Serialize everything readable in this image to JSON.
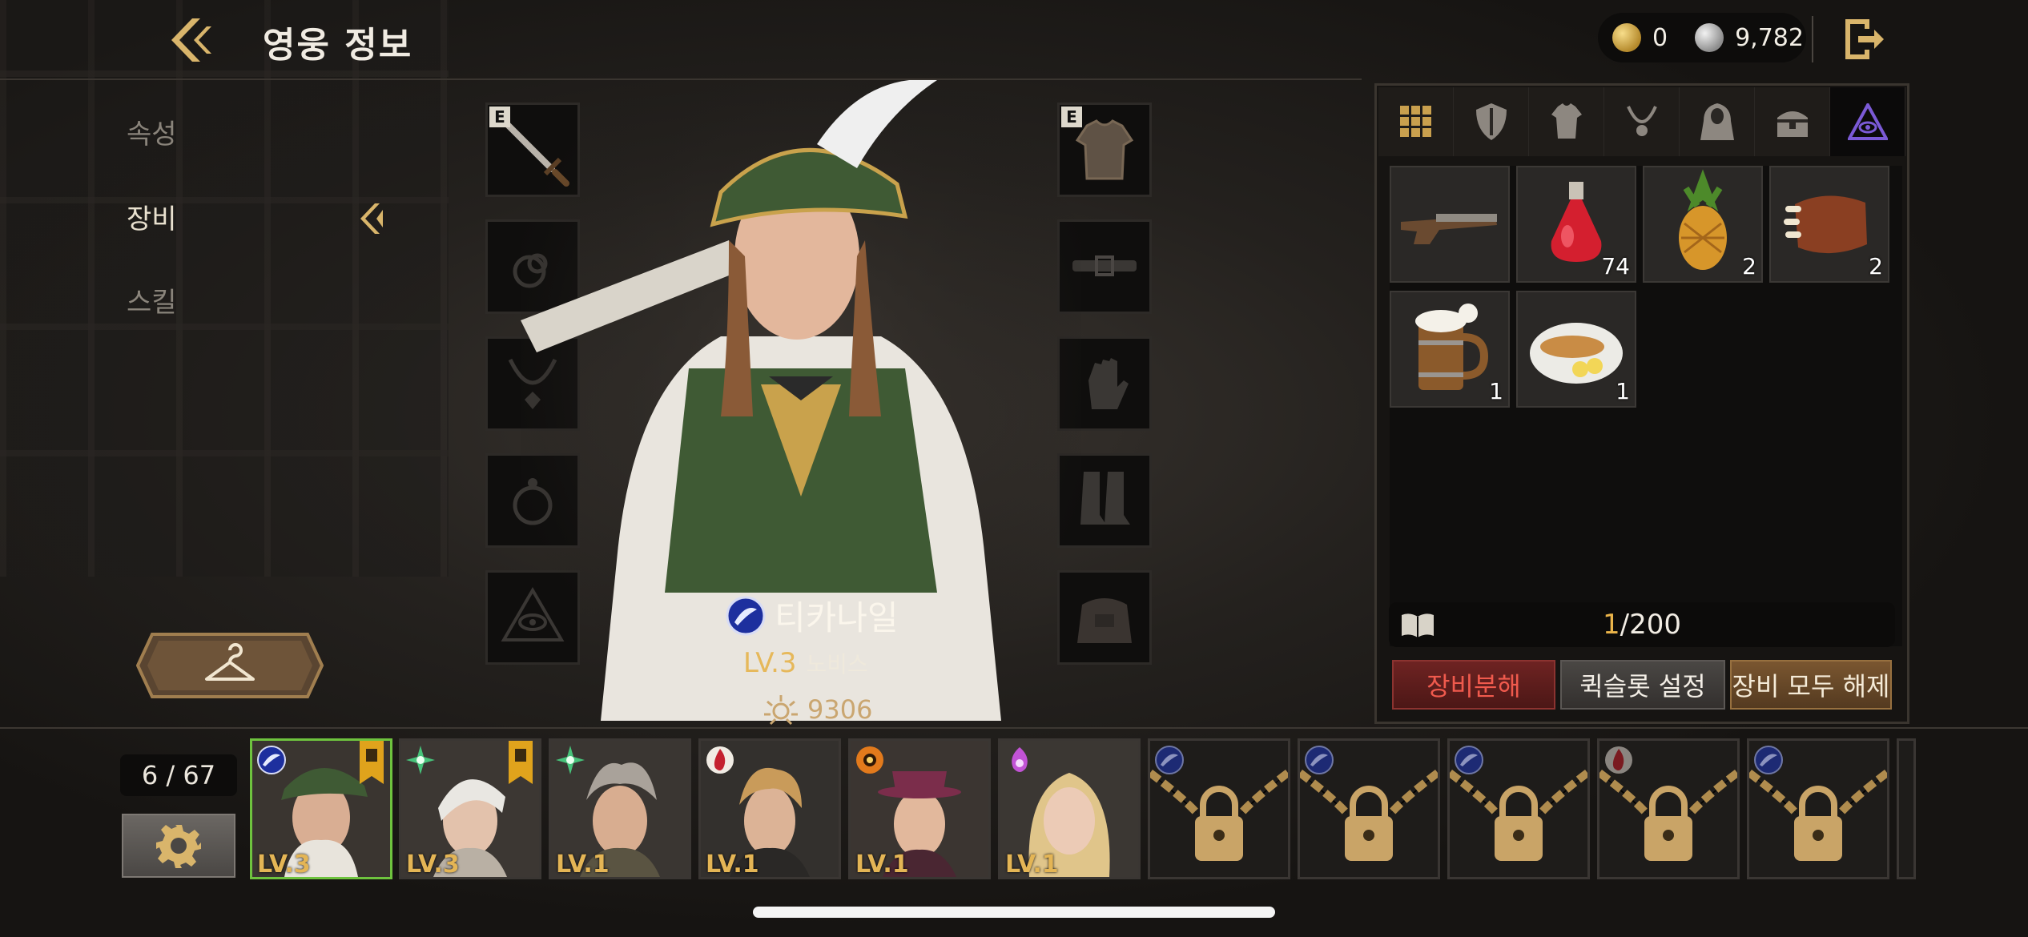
{
  "header": {
    "title": "영웅 정보",
    "currency": [
      {
        "icon": "gold-coin-icon",
        "value": "0"
      },
      {
        "icon": "silver-coin-icon",
        "value": "9,782"
      }
    ]
  },
  "side_menu": {
    "items": [
      {
        "label": "속성",
        "active": false
      },
      {
        "label": "장비",
        "active": true
      },
      {
        "label": "스킬",
        "active": false
      }
    ]
  },
  "equipment": {
    "left_slots": [
      {
        "slot": "weapon",
        "equipped": true,
        "badge": "E",
        "icon": "sword-icon"
      },
      {
        "slot": "ring",
        "equipped": false,
        "icon": "ring-icon"
      },
      {
        "slot": "necklace",
        "equipped": false,
        "icon": "necklace-icon"
      },
      {
        "slot": "earring",
        "equipped": false,
        "icon": "earring-icon"
      },
      {
        "slot": "artifact",
        "equipped": false,
        "icon": "eye-triangle-icon"
      }
    ],
    "right_slots": [
      {
        "slot": "armor",
        "equipped": true,
        "badge": "E",
        "icon": "armor-icon"
      },
      {
        "slot": "belt",
        "equipped": false,
        "icon": "belt-icon"
      },
      {
        "slot": "gloves",
        "equipped": false,
        "icon": "gloves-icon"
      },
      {
        "slot": "boots",
        "equipped": false,
        "icon": "boots-icon"
      },
      {
        "slot": "bag",
        "equipped": false,
        "icon": "bag-icon"
      }
    ]
  },
  "hero": {
    "name": "티카나일",
    "level": "LV.3",
    "rank": "노비스",
    "power": "9306",
    "element": "water-element-icon"
  },
  "inventory": {
    "tabs": [
      {
        "icon": "grid-icon",
        "active": false
      },
      {
        "icon": "shield-icon",
        "active": false
      },
      {
        "icon": "armor-icon",
        "active": false
      },
      {
        "icon": "necklace-icon",
        "active": false
      },
      {
        "icon": "cloak-icon",
        "active": false
      },
      {
        "icon": "chest-icon",
        "active": false
      },
      {
        "icon": "eye-triangle-icon",
        "active": true
      }
    ],
    "items": [
      {
        "name": "flintlock-pistol",
        "count": ""
      },
      {
        "name": "red-potion",
        "count": "74"
      },
      {
        "name": "pineapple",
        "count": "2"
      },
      {
        "name": "roast-ribs",
        "count": "2"
      },
      {
        "name": "beer-mug",
        "count": "1"
      },
      {
        "name": "fish-plate",
        "count": "1"
      }
    ],
    "capacity_current": "1",
    "capacity_max": "/200",
    "buttons": {
      "dismantle": "장비분해",
      "quickslot": "퀵슬롯 설정",
      "unequip_all": "장비 모두 해제"
    }
  },
  "roster": {
    "count": "6 / 67",
    "heroes": [
      {
        "level": "LV.3",
        "element": "water",
        "selected": true,
        "flag": true,
        "locked": false
      },
      {
        "level": "LV.3",
        "element": "wind",
        "selected": false,
        "flag": true,
        "locked": false
      },
      {
        "level": "LV.1",
        "element": "wind",
        "selected": false,
        "flag": false,
        "locked": false
      },
      {
        "level": "LV.1",
        "element": "fire",
        "selected": false,
        "flag": false,
        "locked": false
      },
      {
        "level": "LV.1",
        "element": "sun",
        "selected": false,
        "flag": false,
        "locked": false
      },
      {
        "level": "LV.1",
        "element": "spirit",
        "selected": false,
        "flag": false,
        "locked": false
      },
      {
        "level": "",
        "element": "water",
        "locked": true
      },
      {
        "level": "",
        "element": "water",
        "locked": true
      },
      {
        "level": "",
        "element": "water",
        "locked": true
      },
      {
        "level": "",
        "element": "fire",
        "locked": true
      },
      {
        "level": "",
        "element": "water",
        "locked": true
      }
    ]
  },
  "colors": {
    "accent_gold": "#e6b85a",
    "selected_border": "#6ec33e",
    "dismantle_red": "#f05a4d"
  }
}
